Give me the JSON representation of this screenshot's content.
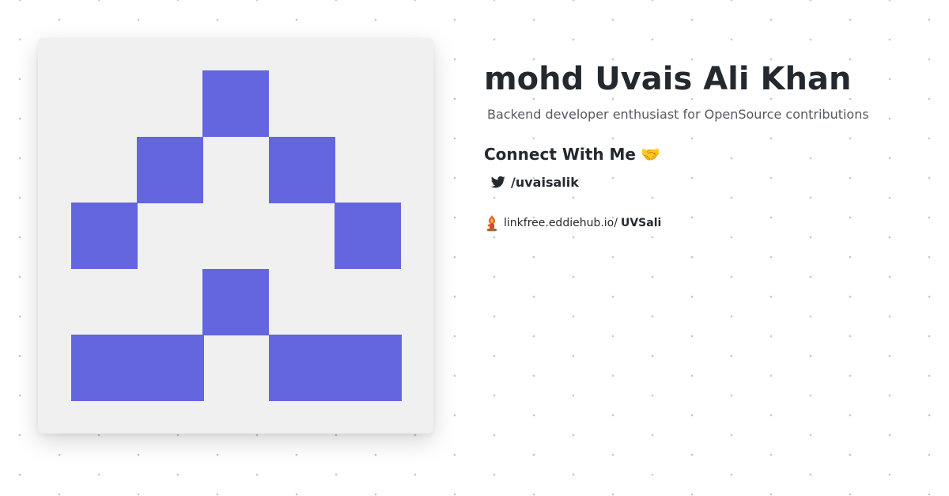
{
  "profile": {
    "name": "mohd Uvais Ali Khan",
    "bio": "Backend developer enthusiast for OpenSource contributions"
  },
  "connect": {
    "heading": "Connect With Me",
    "emoji": "🤝"
  },
  "socials": [
    {
      "icon": "twitter-icon",
      "handle": "/uvaisalik"
    }
  ],
  "linkfree": {
    "icon": "linkfree-logo-icon",
    "domain": "linkfree.eddiehub.io/",
    "username": "UVSali"
  },
  "avatar": {
    "type": "identicon",
    "color": "#6366df",
    "background": "#f0f0f0"
  },
  "colors": {
    "text": "#24292f",
    "muted": "#555a60",
    "dots": "#c4c4c4"
  }
}
